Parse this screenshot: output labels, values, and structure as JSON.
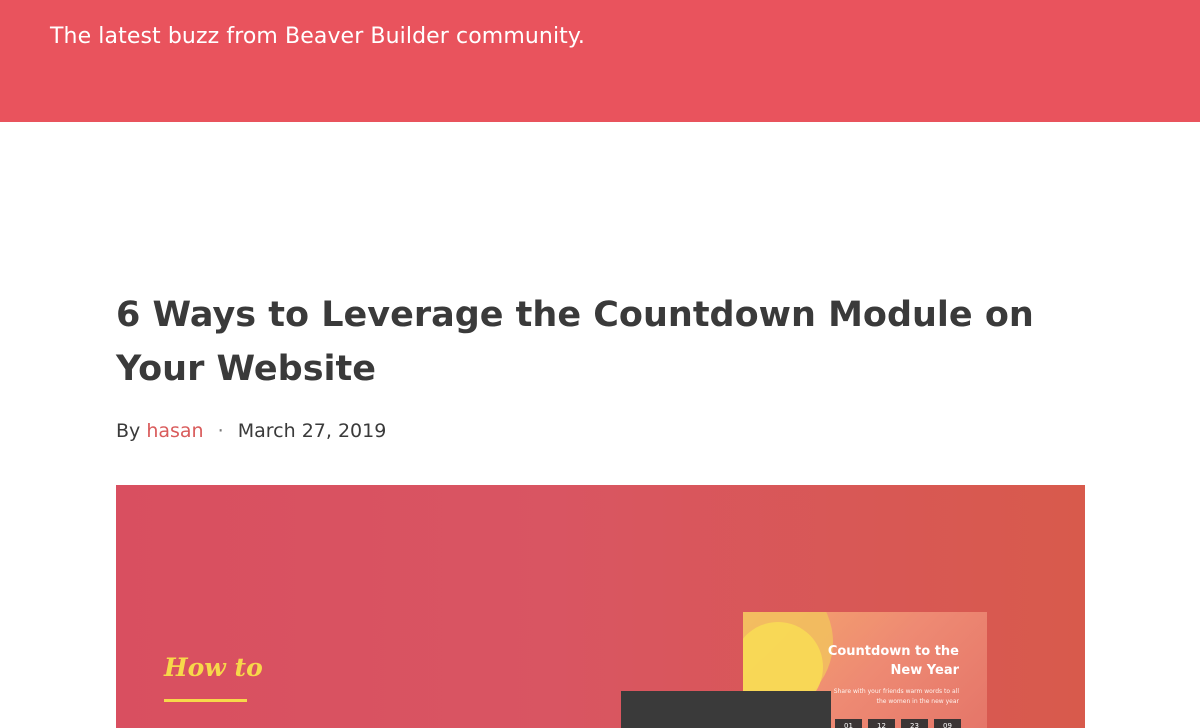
{
  "header": {
    "tagline": "The latest buzz from Beaver Builder community.",
    "background_color": "#e9535d"
  },
  "post": {
    "title": "6 Ways to Leverage the Countdown Module on Your Website",
    "by_label": "By",
    "author": "hasan",
    "separator": "·",
    "date": "March 27, 2019"
  },
  "featured_image": {
    "howto_text": "How to",
    "card_title": "Countdown to the New Year",
    "card_subtitle": "Share with your friends warm words to all the women in the new year",
    "timer_values": [
      "01",
      "12",
      "23",
      "09"
    ]
  },
  "colors": {
    "accent": "#e9535d",
    "author_link": "#d95b5b",
    "howto_yellow": "#f7d84a"
  }
}
